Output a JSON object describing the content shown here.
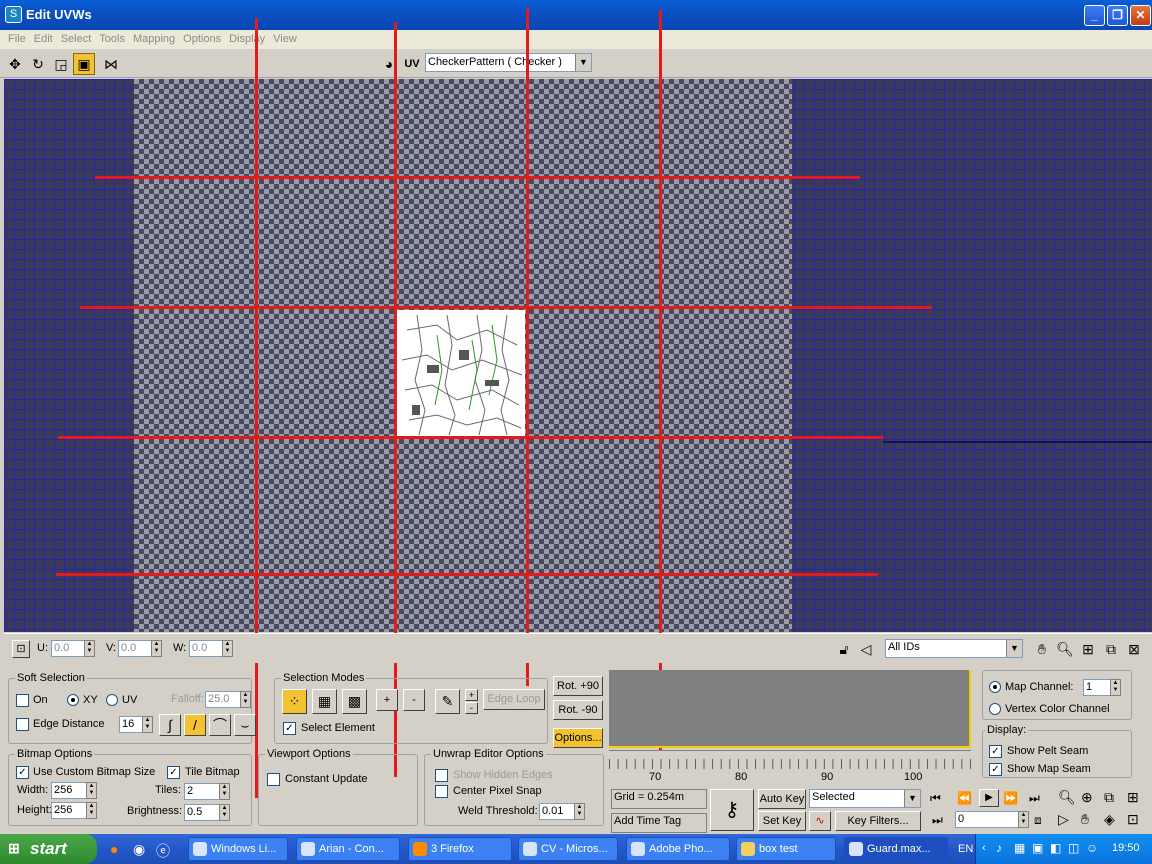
{
  "window": {
    "title": "Edit UVWs",
    "minimize": "_",
    "restore": "❐",
    "close": "✕"
  },
  "menu": [
    "File",
    "Edit",
    "Select",
    "Tools",
    "Mapping",
    "Options",
    "Display",
    "View"
  ],
  "toolbar": {
    "uv_label": "UV",
    "map_select": "CheckerPattern  ( Checker )"
  },
  "vpbar": {
    "u_label": "U:",
    "u_value": "0.0",
    "v_label": "V:",
    "v_value": "0.0",
    "w_label": "W:",
    "w_value": "0.0",
    "ids_select": "All IDs"
  },
  "soft_selection": {
    "title": "Soft Selection",
    "on_label": "On",
    "xy_label": "XY",
    "uv_label": "UV",
    "falloff_label": "Falloff:",
    "falloff_value": "25.0",
    "edge_distance_label": "Edge Distance",
    "edge_distance_value": "16"
  },
  "bitmap_options": {
    "title": "Bitmap Options",
    "use_custom_label": "Use Custom Bitmap Size",
    "tile_bitmap_label": "Tile Bitmap",
    "width_label": "Width:",
    "width_value": "256",
    "height_label": "Height:",
    "height_value": "256",
    "tiles_label": "Tiles:",
    "tiles_value": "2",
    "brightness_label": "Brightness:",
    "brightness_value": "0.5"
  },
  "selection_modes": {
    "title": "Selection Modes",
    "plus": "+",
    "minus": "-",
    "edge_loop": "Edge Loop",
    "select_element_label": "Select Element"
  },
  "rotate": {
    "rot_plus": "Rot. +90",
    "rot_minus": "Rot. -90",
    "options": "Options..."
  },
  "viewport_options": {
    "title": "Viewport Options",
    "constant_update_label": "Constant Update"
  },
  "unwrap_editor": {
    "title": "Unwrap Editor Options",
    "show_hidden_label": "Show Hidden Edges",
    "center_pixel_label": "Center Pixel Snap",
    "weld_threshold_label": "Weld Threshold:",
    "weld_threshold_value": "0.01"
  },
  "timeline": {
    "ticks": [
      "70",
      "80",
      "90",
      "100"
    ]
  },
  "status": {
    "grid": "Grid = 0.254m",
    "add_time_tag": "Add Time Tag",
    "auto_key": "Auto Key",
    "set_key": "Set Key",
    "selected": "Selected",
    "key_filters": "Key Filters...",
    "frame": "0"
  },
  "channel": {
    "map_channel_label": "Map Channel:",
    "map_channel_value": "1",
    "vertex_color_label": "Vertex Color Channel",
    "display_title": "Display:",
    "show_pelt_label": "Show Pelt Seam",
    "show_map_label": "Show Map Seam"
  },
  "taskbar": {
    "start": "start",
    "tasks": [
      "Windows Li...",
      "Arian - Con...",
      "3 Firefox",
      "CV - Micros...",
      "Adobe Pho...",
      "box test",
      "Guard.max..."
    ],
    "lang": "EN",
    "clock": "19:50"
  }
}
